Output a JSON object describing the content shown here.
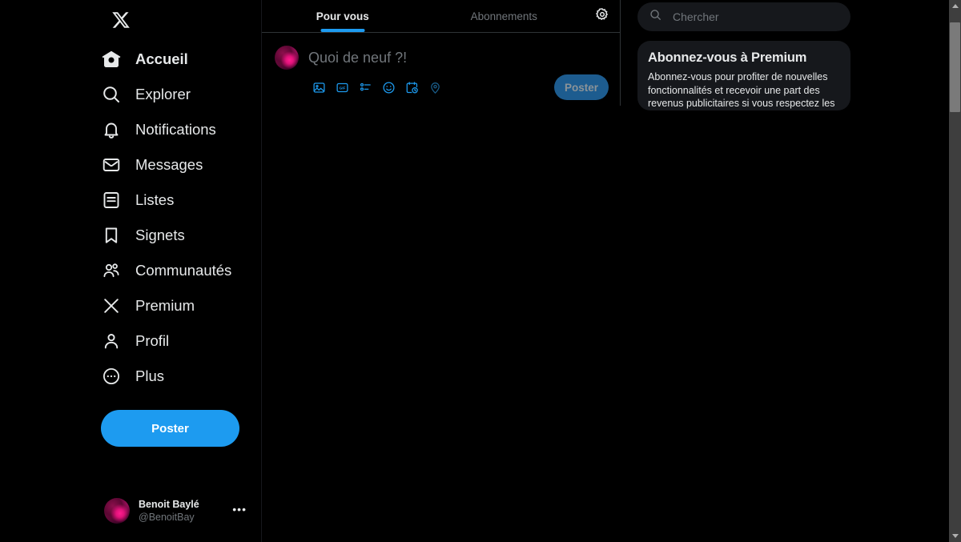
{
  "sidebar": {
    "logo": "x-logo",
    "items": [
      {
        "label": "Accueil",
        "icon": "home-icon",
        "active": true
      },
      {
        "label": "Explorer",
        "icon": "search-icon",
        "active": false
      },
      {
        "label": "Notifications",
        "icon": "bell-icon",
        "active": false
      },
      {
        "label": "Messages",
        "icon": "envelope-icon",
        "active": false
      },
      {
        "label": "Listes",
        "icon": "list-icon",
        "active": false
      },
      {
        "label": "Signets",
        "icon": "bookmark-icon",
        "active": false
      },
      {
        "label": "Communautés",
        "icon": "communities-icon",
        "active": false
      },
      {
        "label": "Premium",
        "icon": "x-premium-icon",
        "active": false
      },
      {
        "label": "Profil",
        "icon": "person-icon",
        "active": false
      },
      {
        "label": "Plus",
        "icon": "more-circle-icon",
        "active": false
      }
    ],
    "post_button_label": "Poster",
    "account": {
      "display_name": "Benoit Baylé",
      "handle": "@BenoitBay",
      "menu_glyph": "•••"
    }
  },
  "center": {
    "tabs": [
      {
        "label": "Pour vous",
        "active": true
      },
      {
        "label": "Abonnements",
        "active": false
      }
    ],
    "settings_icon": "gear-icon",
    "composer": {
      "placeholder": "Quoi de neuf ?!",
      "post_label": "Poster",
      "tools": [
        {
          "name": "media-image-icon"
        },
        {
          "name": "gif-icon"
        },
        {
          "name": "poll-icon"
        },
        {
          "name": "emoji-icon"
        },
        {
          "name": "schedule-icon"
        },
        {
          "name": "location-icon"
        }
      ]
    }
  },
  "right": {
    "search": {
      "placeholder": "Chercher",
      "value": "",
      "icon": "search-icon"
    },
    "premium_card": {
      "title": "Abonnez-vous à Premium",
      "body": "Abonnez-vous pour profiter de nouvelles fonctionnalités et recevoir une part des revenus publicitaires si vous respectez les"
    }
  },
  "colors": {
    "background": "#000000",
    "accent_blue": "#1d9bf0",
    "muted_text": "#71767b",
    "primary_text": "#e7e9ea",
    "card_bg": "#16181c",
    "border": "#2f3336"
  }
}
